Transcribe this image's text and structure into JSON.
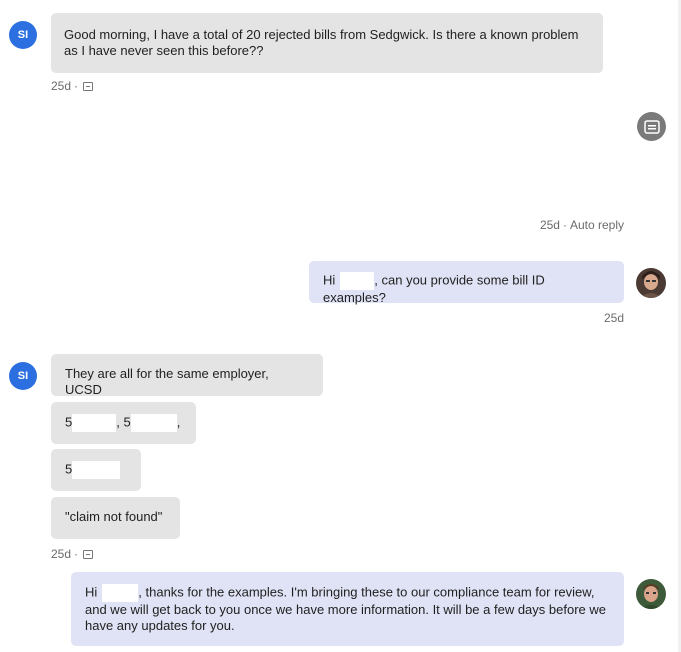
{
  "messages": {
    "m1": {
      "avatar_initials": "SI",
      "text": "Good morning, I have a total of 20 rejected bills from Sedgwick. Is there a known problem as I have never seen this before??",
      "time": "25d",
      "sep": "·"
    },
    "auto": {
      "time": "25d",
      "sep": "·",
      "label": "Auto reply"
    },
    "m2": {
      "prefix": "Hi",
      "suffix": ", can you provide some bill ID examples?",
      "time": "25d"
    },
    "m3": {
      "avatar_initials": "SI",
      "line1": "They are all for the same employer, UCSD",
      "line2_a": "5",
      "line2_b": ", 5",
      "line2_c": ",",
      "line3": "5",
      "line4": "\"claim not found\"",
      "time": "25d",
      "sep": "·"
    },
    "m4": {
      "prefix": "Hi",
      "suffix": ", thanks for the examples. I'm bringing these to our compliance team for review, and we will get back to you once we have more information. It will be a few days before we have any updates for you."
    }
  },
  "icons": {
    "auto_reply_bot": "bot-icon",
    "seen": "message-seen-icon"
  },
  "colors": {
    "initials_avatar": "#2b6fe0",
    "incoming_bubble": "#e4e4e4",
    "outgoing_bubble": "#e0e3f5",
    "bot_avatar": "#7a7a7a"
  }
}
